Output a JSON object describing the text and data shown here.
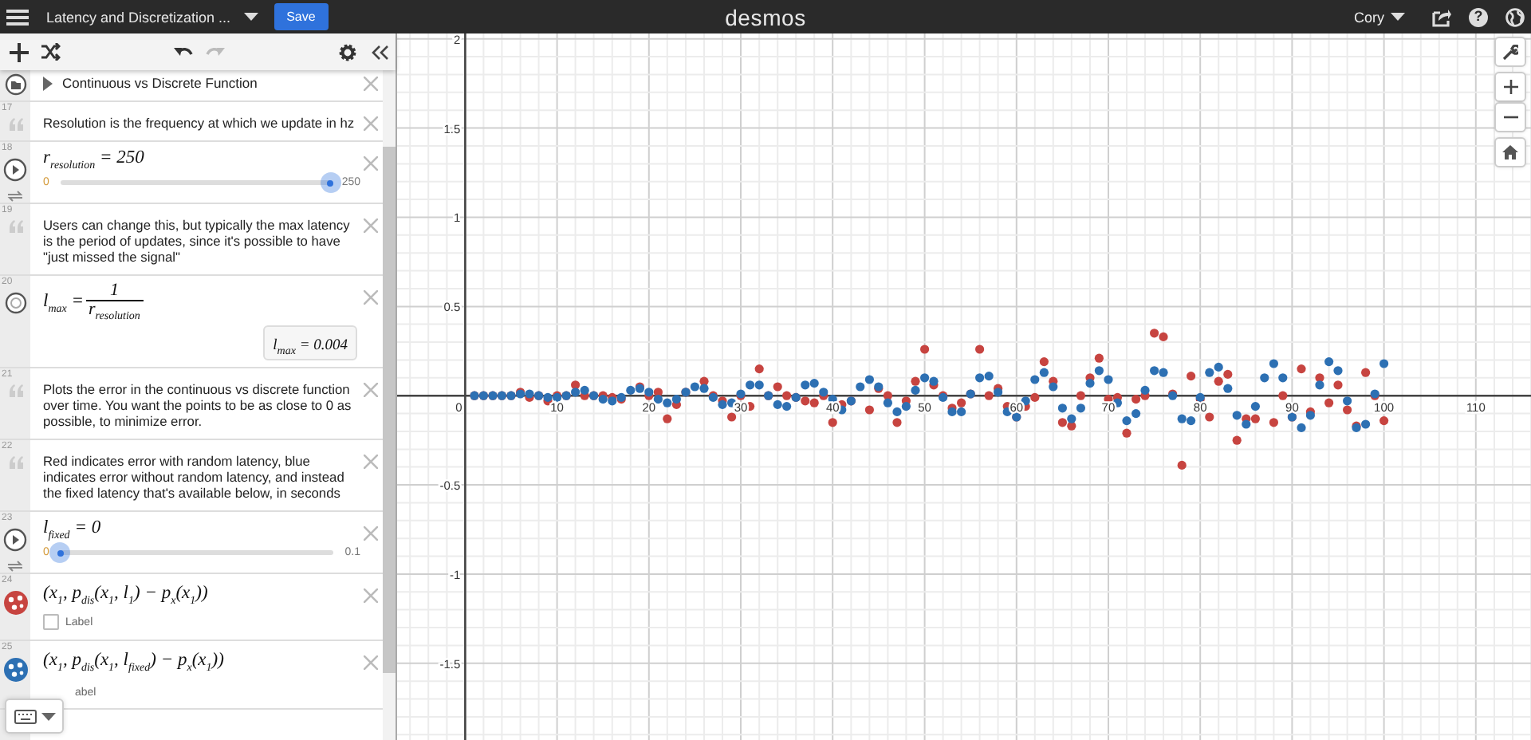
{
  "top_bar": {
    "title": "Latency and Discretization ...",
    "save": "Save",
    "logo": "desmos",
    "user": "Cory",
    "help": "?"
  },
  "toolbar": {
    "redo_disabled": true
  },
  "expressions": [
    {
      "kind": "folder",
      "text": "Continuous vs Discrete Function",
      "expanded": false
    },
    {
      "kind": "note",
      "number": "17",
      "text": "Resolution is the frequency at which we update in hz"
    },
    {
      "kind": "slider",
      "number": "18",
      "expr": "r$_{resolution}$ = 250",
      "min": "0",
      "max": "250",
      "level": 1
    },
    {
      "kind": "note",
      "number": "19",
      "text": "Users can change this, but typically the max latency is the period of updates, since it's possible to have \"just missed the signal\""
    },
    {
      "kind": "fraction",
      "number": "20",
      "lhs": "l$_{max}$ =",
      "numerator": "1",
      "denominator": "r$_{resolution}$",
      "result": "l$_{max}$ = 0.004"
    },
    {
      "kind": "note",
      "number": "21",
      "text": "Plots the error in the continuous vs discrete function over time. You want the points to be as close to 0 as possible, to minimize error."
    },
    {
      "kind": "note",
      "number": "22",
      "text": "Red indicates error with random latency, blue indicates error without random latency, and instead the fixed latency that's available below, in seconds"
    },
    {
      "kind": "slider",
      "number": "23",
      "expr": "l$_{fixed}$ = 0",
      "min": "0",
      "max": "0.1",
      "level": 0
    },
    {
      "kind": "points",
      "number": "24",
      "expr": "(x$_{1}$, p$_{dis}$(x$_{1}$, l$_{1}$) − p$_{x}$(x$_{1}$))",
      "color": "#c74440",
      "label": "Label",
      "checked": false
    },
    {
      "kind": "points",
      "number": "25",
      "expr": "(x$_{1}$, p$_{dis}$(x$_{1}$, l$_{fixed}$) − p$_{x}$(x$_{1}$))",
      "color": "#2d70b3",
      "label": "abel"
    }
  ],
  "graph": {
    "chart_data": {
      "type": "scatter",
      "grid": true,
      "xlim": [
        -7.41,
        116
      ],
      "ylim": [
        -1.93,
        2.03
      ],
      "xticks": [
        0,
        10,
        20,
        30,
        40,
        50,
        60,
        70,
        80,
        90,
        100,
        110
      ],
      "yticks": [
        -1.5,
        -1,
        -0.5,
        0.5,
        1,
        1.5,
        2
      ],
      "x": [
        1,
        2,
        3,
        4,
        5,
        6,
        7,
        8,
        9,
        10,
        11,
        12,
        13,
        14,
        15,
        16,
        17,
        18,
        19,
        20,
        21,
        22,
        23,
        24,
        25,
        26,
        27,
        28,
        29,
        30,
        31,
        32,
        33,
        34,
        35,
        36,
        37,
        38,
        39,
        40,
        41,
        42,
        43,
        44,
        45,
        46,
        47,
        48,
        49,
        50,
        51,
        52,
        53,
        54,
        55,
        56,
        57,
        58,
        59,
        60,
        61,
        62,
        63,
        64,
        65,
        66,
        67,
        68,
        69,
        70,
        71,
        72,
        73,
        74,
        75,
        76,
        77,
        78,
        79,
        80,
        81,
        82,
        83,
        84,
        85,
        86,
        87,
        88,
        89,
        90,
        91,
        92,
        93,
        94,
        95,
        96,
        97,
        98,
        99,
        100
      ],
      "series": [
        {
          "color": "#c74440",
          "values": [
            0,
            0,
            0,
            0,
            0,
            0.02,
            -0.01,
            0,
            -0.03,
            0,
            0,
            0.06,
            0,
            0,
            0,
            -0.01,
            -0.02,
            null,
            0.05,
            0,
            0.02,
            -0.13,
            -0.05,
            0.02,
            null,
            0.08,
            0,
            -0.03,
            -0.12,
            0,
            -0.06,
            0.15,
            0,
            0.05,
            0,
            -0.01,
            -0.03,
            -0.04,
            0,
            -0.15,
            -0.05,
            -0.03,
            null,
            -0.08,
            0.04,
            0,
            -0.15,
            -0.03,
            0.08,
            0.26,
            0.06,
            0,
            -0.07,
            -0.04,
            0.01,
            0.26,
            0,
            0.04,
            -0.06,
            -0.12,
            -0.06,
            -0.01,
            0.19,
            0.08,
            -0.15,
            -0.17,
            0,
            0.1,
            0.21,
            -0.02,
            -0.01,
            -0.21,
            -0.02,
            0,
            0.35,
            0.33,
            0.01,
            -0.39,
            0.11,
            -0.02,
            -0.12,
            0.08,
            0.12,
            -0.25,
            -0.13,
            -0.13,
            null,
            -0.15,
            0,
            -0.12,
            0.15,
            -0.09,
            0.1,
            -0.04,
            0.06,
            -0.08,
            -0.17,
            0.13,
            0,
            -0.14
          ]
        },
        {
          "color": "#2d70b3",
          "values": [
            0,
            0,
            0,
            0,
            0,
            0.01,
            0.01,
            0,
            -0.01,
            -0.01,
            0,
            0.02,
            0.03,
            0,
            -0.02,
            -0.03,
            -0.01,
            0.03,
            0.04,
            0.02,
            -0.02,
            -0.04,
            -0.02,
            0.02,
            0.05,
            0.04,
            -0.01,
            -0.05,
            -0.04,
            0.01,
            0.06,
            0.06,
            0,
            -0.05,
            -0.06,
            -0.01,
            0.06,
            0.07,
            0.02,
            -0.02,
            -0.08,
            -0.03,
            0.05,
            0.09,
            0.05,
            -0.04,
            -0.09,
            -0.06,
            0.03,
            0.1,
            0.08,
            -0.01,
            -0.09,
            -0.09,
            0.01,
            0.1,
            0.11,
            0.02,
            -0.09,
            -0.12,
            -0.03,
            0.09,
            0.13,
            0.05,
            -0.07,
            -0.13,
            -0.07,
            0.07,
            0.14,
            0.09,
            -0.04,
            -0.14,
            -0.1,
            0.03,
            0.14,
            0.13,
            0,
            -0.13,
            -0.14,
            -0.01,
            0.13,
            0.16,
            0.04,
            -0.11,
            -0.16,
            -0.06,
            0.1,
            0.18,
            0.1,
            -0.12,
            -0.18,
            -0.11,
            0.06,
            0.19,
            0.14,
            -0.03,
            -0.18,
            -0.16,
            0.01,
            0.18
          ]
        }
      ]
    }
  }
}
